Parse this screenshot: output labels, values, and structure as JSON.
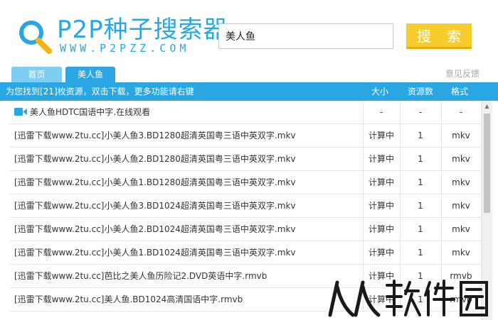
{
  "header": {
    "logo_title": "P2P种子搜索器",
    "logo_url": "WWW.P2PZZ.COM",
    "search_value": "美人鱼",
    "search_button": "搜 索"
  },
  "tabs": [
    {
      "label": "首页",
      "active": false
    },
    {
      "label": "美人鱼",
      "active": true
    }
  ],
  "feedback": "意见反馈",
  "columns": {
    "summary": "为您找到[21]枚资源，双击下载，更多功能请右键",
    "size": "大小",
    "count": "资源数",
    "format": "格式"
  },
  "results": [
    {
      "name": "美人鱼HDTC国语中字.在线观看",
      "size": "-",
      "count": "-",
      "format": "-",
      "icon": "camera-icon"
    },
    {
      "name": "[迅雷下载www.2tu.cc]小美人鱼3.BD1280超清英国粤三语中英双字.mkv",
      "size": "计算中",
      "count": "1",
      "format": "mkv"
    },
    {
      "name": "[迅雷下载www.2tu.cc]小美人鱼2.BD1280超清英国粤三语中英双字.mkv",
      "size": "计算中",
      "count": "1",
      "format": "mkv"
    },
    {
      "name": "[迅雷下载www.2tu.cc]小美人鱼1.BD1280超清英国粤三语中英双字.mkv",
      "size": "计算中",
      "count": "1",
      "format": "mkv"
    },
    {
      "name": "[迅雷下载www.2tu.cc]小美人鱼3.BD1024超清英国粤三语中英双字.mkv",
      "size": "计算中",
      "count": "1",
      "format": "mkv"
    },
    {
      "name": "[迅雷下载www.2tu.cc]小美人鱼2.BD1024超清英国粤三语中英双字.mkv",
      "size": "计算中",
      "count": "1",
      "format": "mkv"
    },
    {
      "name": "[迅雷下载www.2tu.cc]小美人鱼1.BD1024超清英国粤三语中英双字.mkv",
      "size": "计算中",
      "count": "1",
      "format": "mkv"
    },
    {
      "name": "[迅雷下载www.2tu.cc]芭比之美人鱼历险记2.DVD英语中字.rmvb",
      "size": "计算中",
      "count": "1",
      "format": "rmvb"
    },
    {
      "name": "[迅雷下载www.2tu.cc]美人鱼.BD1024高清国语中字.rmvb",
      "size": "计算中",
      "count": "1",
      "format": "rmvb"
    }
  ],
  "colors": {
    "brand_blue": "#2aa7e2",
    "search_yellow": "#f7cd2e"
  },
  "watermark": "人人软件园"
}
